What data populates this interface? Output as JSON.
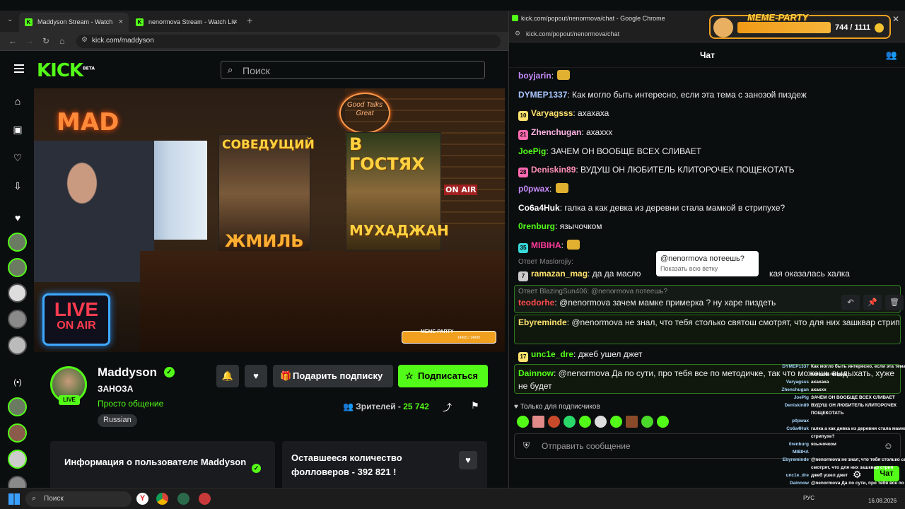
{
  "browser_left": {
    "tabs": [
      {
        "title": "Maddyson Stream - Watch",
        "close": "×"
      },
      {
        "title": "nenormova Stream - Watch Liv",
        "close": "×"
      }
    ],
    "new_tab": "+",
    "url": "kick.com/maddyson"
  },
  "kick": {
    "logo": "KICK",
    "logo_badge": "BETA",
    "search_placeholder": "Поиск"
  },
  "video_overlay": {
    "mad": "MAD",
    "poster1_top": "СОВЕДУЩИЙ",
    "poster1_bottom": "ЖМИЛЬ",
    "poster2_top": "В ГОСТЯХ",
    "poster2_bottom": "МУХАДЖАН",
    "on_air": "ON AIR",
    "sign": "Good Talks Great",
    "live_neon_l1": "LIVE",
    "live_neon_l2": "ON AIR",
    "mini_meme": "MEME-PARTY",
    "mini_meme_count": "14605 / 14900"
  },
  "channel": {
    "name": "Maddyson",
    "live_label": "LIVE",
    "stream_title": "ЗАНОЗА",
    "category": "Просто общение",
    "language": "Russian",
    "gift_label": "Подарить подписку",
    "subscribe_label": "Подписаться",
    "viewers_label": "Зрителей - ",
    "viewers_count": "25 742",
    "card_info": "Информация о пользователе Maddyson",
    "card_followers": "Оставшееся количество фолловеров - 392 821 !"
  },
  "chat_window": {
    "window_title": "kick.com/popout/nenormova/chat - Google Chrome",
    "url": "kick.com/popout/nenormova/chat",
    "header": "Чат",
    "messages": [
      {
        "user": "boyjarin",
        "color": "#c58af9",
        "text": ""
      },
      {
        "user": "DYMEP1337",
        "color": "#a9c7ff",
        "text": "Как могло быть интересно, если эта тема с занозой пиздеж"
      },
      {
        "user": "Varyagsss",
        "color": "#ffe36e",
        "text": "ахахаха",
        "badge": "10"
      },
      {
        "user": "Zhenchugan",
        "color": "#ffb3e6",
        "text": "ахахxx",
        "badge": "21"
      },
      {
        "user": "JoePig",
        "color": "#53fc18",
        "text": "ЗАЧЕМ ОН ВООБЩЕ ВСЕХ СЛИВАЕТ"
      },
      {
        "user": "Deniskin89",
        "color": "#ff8fb7",
        "text": "ВУДУШ ОН ЛЮБИТЕЛЬ КЛИТОРОЧЕК ПОЩЕКОТАТЬ",
        "badge": "28"
      },
      {
        "user": "p0pwax",
        "color": "#c58af9",
        "text": ""
      },
      {
        "user": "Co6a4Huk",
        "color": "#ffffff",
        "text": "галка а как девка из деревни стала мамкой в стрипухе?"
      },
      {
        "user": "0renburg",
        "color": "#53fc18",
        "text": "язычочком"
      },
      {
        "user": "MIBIHA",
        "color": "#ff3b9a",
        "text": "",
        "badge": "35"
      },
      {
        "user": "ramazan_mag",
        "color": "#ffe36e",
        "text": "да да масло",
        "badge": "7",
        "tail": "кая оказалась халка"
      }
    ],
    "reply1": "Ответ Maslorojiy:",
    "tooltip_text": "@nenormova потеешь?",
    "tooltip_link": "Показать всю ветку",
    "reply2": "Ответ BlazingSun406: @nenormova потеешь?",
    "hl_msg1": {
      "user": "teodorhe",
      "text": "@nenormova зачем мамке примерка ? ну харе пиздеть"
    },
    "hl_msg2": {
      "user": "Ebyreminde",
      "text": "@nenormova не знал, что тебя столько святош смотрят, что для них зашквар стрип"
    },
    "msg_plain": {
      "user": "unc1e_dre",
      "text": "джеб ушел джет",
      "badge": "17"
    },
    "hl_msg3": {
      "user": "Dainnow",
      "text": "@nenormova Да по сути, про тебя все по методичке, так что можешь выдыхать, хуже не будет"
    },
    "subs_only": "Только для подписчиков",
    "input_placeholder": "Отправить сообщение",
    "send_label": "Чат"
  },
  "overlay_chat": [
    {
      "n": "DYMEP1337",
      "t": "Как могло быть интересно, если эта тема с"
    },
    {
      "n": "",
      "t": "занозой пиздеж"
    },
    {
      "n": "Varyagsss",
      "t": "ахахаха"
    },
    {
      "n": "Zhenchugan",
      "t": "ахахxx"
    },
    {
      "n": "JoePig",
      "t": "ЗАЧЕМ ОН ВООБЩЕ ВСЕХ СЛИВАЕТ"
    },
    {
      "n": "Deniskin89",
      "t": "ВУДУШ ОН ЛЮБИТЕЛЬ КЛИТОРОЧЕК"
    },
    {
      "n": "",
      "t": "ПОЩЕКОТАТЬ"
    },
    {
      "n": "p0pwax",
      "t": ""
    },
    {
      "n": "Co6a4Huk",
      "t": "галка а как девка из деревни стала мамкой в"
    },
    {
      "n": "",
      "t": "стрипухе?"
    },
    {
      "n": "0renburg",
      "t": "язычочком"
    },
    {
      "n": "MIBIHA",
      "t": ""
    },
    {
      "n": "Ebyreminde",
      "t": "@nenormova не знал, что тебя столько святош"
    },
    {
      "n": "",
      "t": "смотрят, что для них зашквар стрип"
    },
    {
      "n": "unc1e_dre",
      "t": "джеб ушел джет"
    },
    {
      "n": "Dainnow",
      "t": "@nenormova Да по сути, про тебя все по"
    },
    {
      "n": "",
      "t": "методичке, так что можешь выдыхать, хуже"
    },
    {
      "n": "",
      "t": "не будет"
    }
  ],
  "meme_widget": {
    "title": "MEME-PARTY",
    "count": "744 / 1111"
  },
  "taskbar": {
    "search": "Поиск",
    "lang": "РУС",
    "date": "16.08.2026"
  }
}
